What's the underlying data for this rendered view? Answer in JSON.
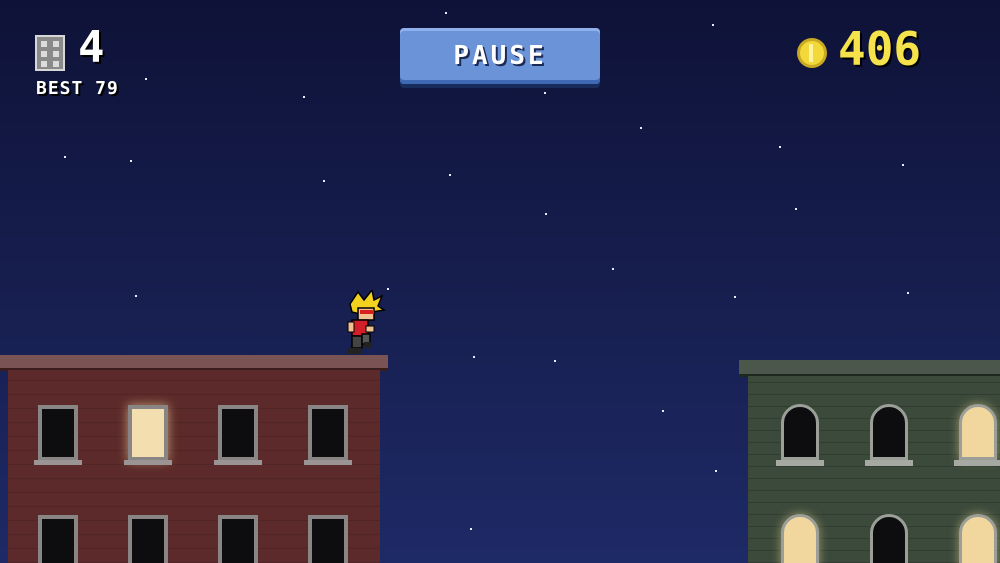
{
  "hud": {
    "floors": "4",
    "best": "BEST 79",
    "coins": "406",
    "pause_label": "PAUSE"
  },
  "icons": {
    "floors_icon": "building-icon",
    "coins_icon": "coin-icon"
  },
  "colors": {
    "sky": "#161d4c",
    "coin_text": "#f6e24a",
    "pause_button": "#6b93d8",
    "left_building": "#5c2a2a",
    "right_building": "#3b4a3b"
  }
}
